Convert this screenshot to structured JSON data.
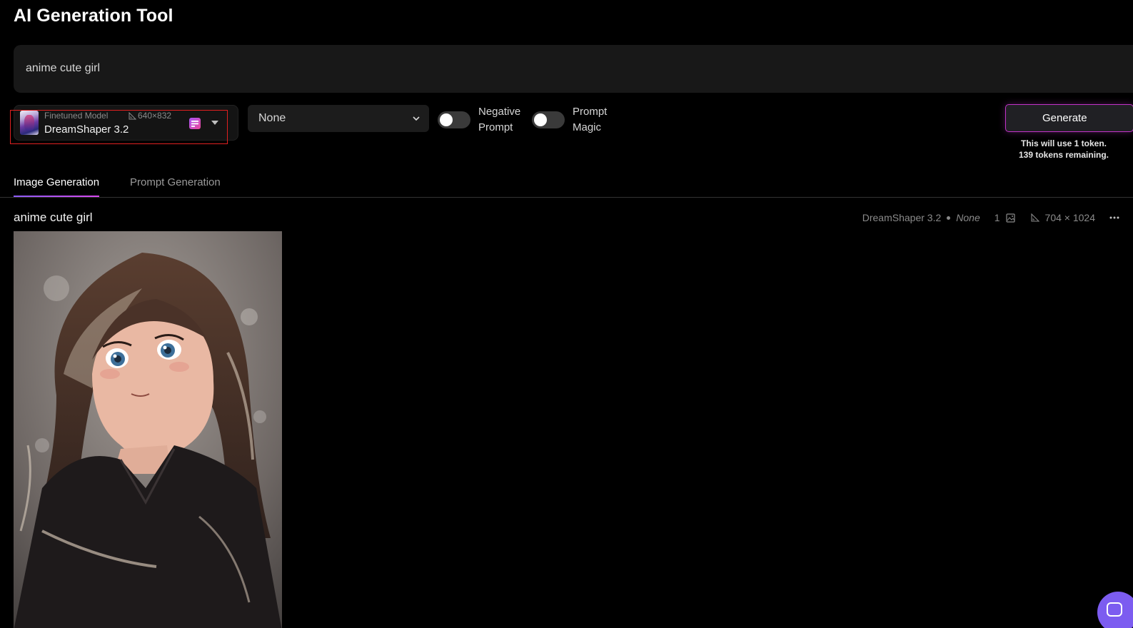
{
  "header": {
    "title": "AI Generation Tool"
  },
  "prompt": {
    "value": "anime cute girl"
  },
  "model": {
    "kind": "Finetuned Model",
    "resolution": "640×832",
    "name": "DreamShaper 3.2"
  },
  "style_select": {
    "value": "None"
  },
  "toggles": {
    "negative_prompt": {
      "label_line1": "Negative",
      "label_line2": "Prompt",
      "on": false
    },
    "prompt_magic": {
      "label_line1": "Prompt",
      "label_line2": "Magic",
      "on": false
    }
  },
  "generate": {
    "label": "Generate",
    "token_line1": "This will use 1 token.",
    "token_line2": "139 tokens remaining."
  },
  "tabs": [
    {
      "label": "Image Generation",
      "active": true
    },
    {
      "label": "Prompt Generation",
      "active": false
    }
  ],
  "generation": {
    "title": "anime cute girl",
    "model": "DreamShaper 3.2",
    "style": "None",
    "count": "1",
    "dimensions": "704 × 1024"
  },
  "colors": {
    "accent_purple": "#8b5cf6",
    "accent_pink": "#d946ef",
    "highlight_red": "#e02020",
    "help_bubble": "#7c5cf0"
  },
  "icons": {
    "model_info": "document-icon",
    "dropdown": "caret-down-icon",
    "style_chevron": "chevron-down-icon",
    "image_count": "image-icon",
    "dimensions": "ruler-triangle-icon",
    "more": "more-horizontal-icon",
    "help": "chat-icon"
  }
}
